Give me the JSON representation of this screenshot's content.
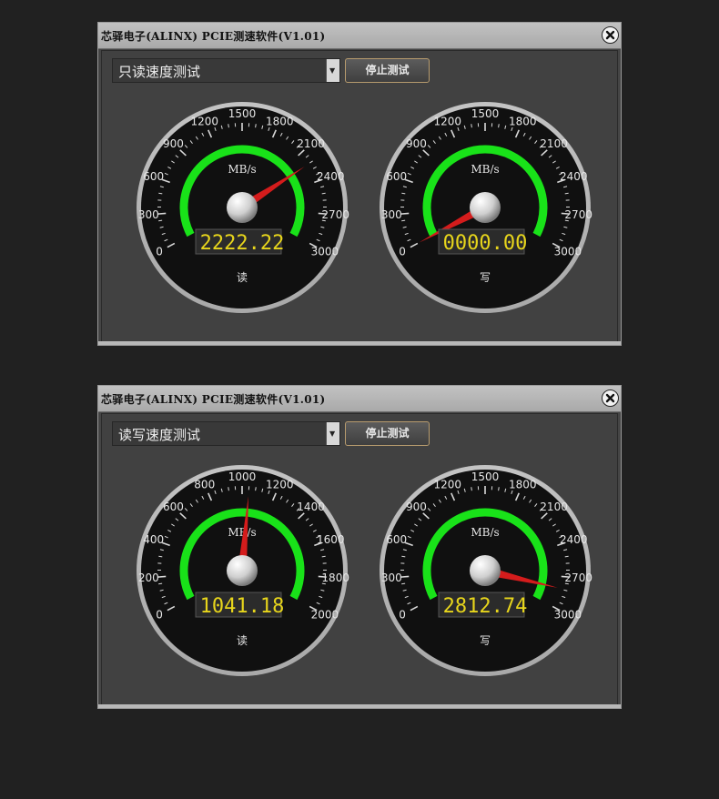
{
  "windows": [
    {
      "title": "芯驿电子(ALINX) PCIE测速软件(V1.01)",
      "mode": "只读速度测试",
      "button": "停止测试",
      "gauges": [
        {
          "label": "读",
          "unit": "MB/s",
          "display": "2222.22",
          "value": 2222.22,
          "max": 3000,
          "ticks": [
            "0",
            "300",
            "600",
            "900",
            "1200",
            "1500",
            "1800",
            "2100",
            "2400",
            "2700",
            "3000"
          ]
        },
        {
          "label": "写",
          "unit": "MB/s",
          "display": "0000.00",
          "value": 0,
          "max": 3000,
          "ticks": [
            "0",
            "300",
            "600",
            "900",
            "1200",
            "1500",
            "1800",
            "2100",
            "2400",
            "2700",
            "3000"
          ]
        }
      ]
    },
    {
      "title": "芯驿电子(ALINX) PCIE测速软件(V1.01)",
      "mode": "读写速度测试",
      "button": "停止测试",
      "gauges": [
        {
          "label": "读",
          "unit": "MB/s",
          "display": "1041.18",
          "value": 1041.18,
          "max": 2000,
          "ticks": [
            "0",
            "200",
            "400",
            "600",
            "800",
            "1000",
            "1200",
            "1400",
            "1600",
            "1800",
            "2000"
          ]
        },
        {
          "label": "写",
          "unit": "MB/s",
          "display": "2812.74",
          "value": 2812.74,
          "max": 3000,
          "ticks": [
            "0",
            "300",
            "600",
            "900",
            "1200",
            "1500",
            "1800",
            "2100",
            "2400",
            "2700",
            "3000"
          ]
        }
      ]
    }
  ],
  "colors": {
    "arc": "#19e219",
    "needle": "#d41c1c",
    "digits": "#e7d51c",
    "dial": "#101010"
  },
  "icons": {
    "close": "close-icon",
    "dropdown": "chevron-down-icon"
  }
}
